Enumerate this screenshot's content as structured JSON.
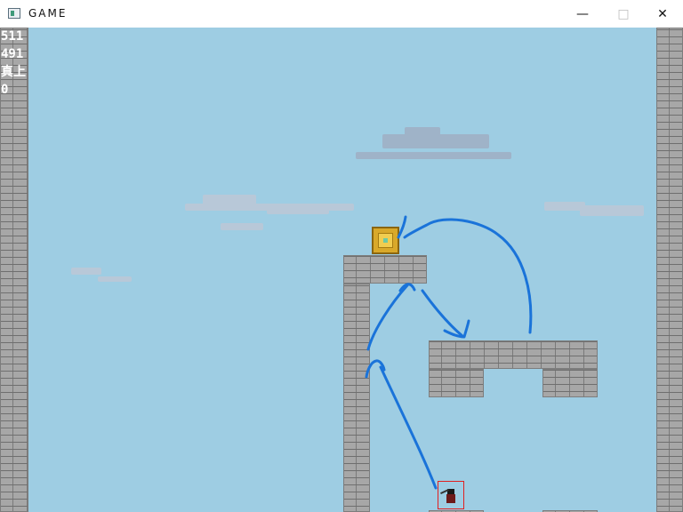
{
  "window": {
    "title": "GAME",
    "minimize_icon": "minimize-icon",
    "maximize_icon": "maximize-icon",
    "close_icon": "close-icon"
  },
  "hud": {
    "line1": "511",
    "line2": "491",
    "line3": "真上",
    "line4": "0"
  },
  "colors": {
    "sky": "#9ecde3",
    "brick": "#a7a7a7",
    "path_stroke": "#1a73d9",
    "player_box": "#e02020",
    "crate": "#d9a92a"
  }
}
